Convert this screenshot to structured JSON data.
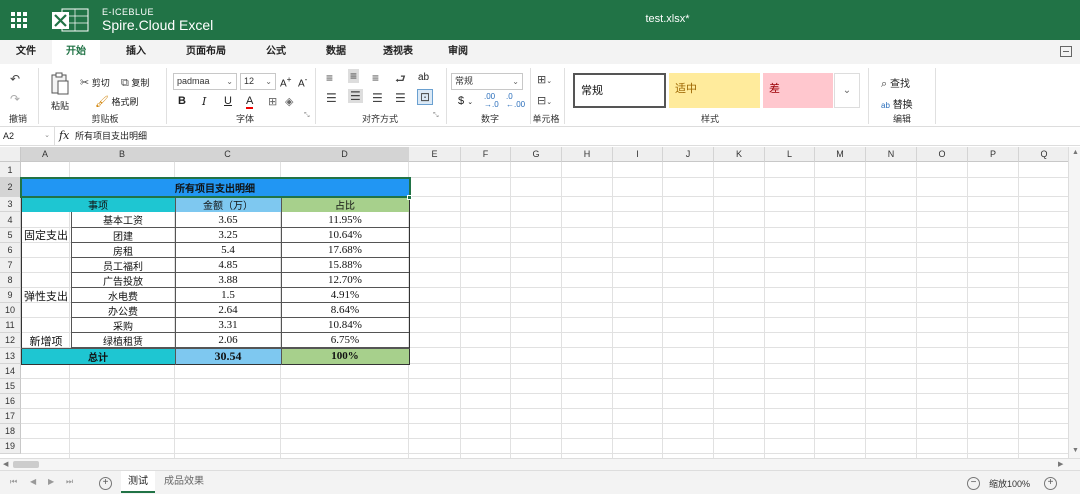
{
  "app": {
    "brand_top": "E-ICEBLUE",
    "brand_name": "Spire.Cloud Excel",
    "doc_title": "test.xlsx*"
  },
  "menu_tabs": [
    "文件",
    "开始",
    "插入",
    "页面布局",
    "公式",
    "数据",
    "透视表",
    "审阅"
  ],
  "ribbon": {
    "undo": "撤销",
    "paste": "粘贴",
    "cut": "剪切",
    "copy": "复制",
    "format_painter": "格式刷",
    "clipboard_label": "剪贴板",
    "font_name": "padmaa",
    "font_size": "12",
    "font_label": "字体",
    "bold": "B",
    "italic": "I",
    "underline": "U",
    "font_color": "A",
    "align_label": "对齐方式",
    "orientation": "ab",
    "number_format": "常规",
    "currency": "$",
    "percent": "%",
    "number_label": "数字",
    "cells_label": "单元格",
    "styles": {
      "normal": "常规",
      "neutral": "适中",
      "bad": "差"
    },
    "styles_label": "样式",
    "find": "查找",
    "replace": "替换",
    "edit_label": "编辑"
  },
  "formula_bar": {
    "cell_ref": "A2",
    "fx": "fx",
    "content": "所有项目支出明细"
  },
  "columns": [
    "A",
    "B",
    "C",
    "D",
    "E",
    "F",
    "G",
    "H",
    "I",
    "J",
    "K",
    "L",
    "M",
    "N",
    "O",
    "P",
    "Q"
  ],
  "rows": [
    "1",
    "2",
    "3",
    "4",
    "5",
    "6",
    "7",
    "8",
    "9",
    "10",
    "11",
    "12",
    "13",
    "14",
    "15",
    "16",
    "17",
    "18",
    "19"
  ],
  "table": {
    "title": "所有项目支出明细",
    "headers": [
      "事项",
      "金额（万）",
      "占比"
    ],
    "groups": [
      "固定支出",
      "弹性支出",
      "新增项"
    ],
    "items": [
      {
        "name": "基本工资",
        "amount": "3.65",
        "ratio": "11.95%"
      },
      {
        "name": "团建",
        "amount": "3.25",
        "ratio": "10.64%"
      },
      {
        "name": "房租",
        "amount": "5.4",
        "ratio": "17.68%"
      },
      {
        "name": "员工福利",
        "amount": "4.85",
        "ratio": "15.88%"
      },
      {
        "name": "广告投放",
        "amount": "3.88",
        "ratio": "12.70%"
      },
      {
        "name": "水电费",
        "amount": "1.5",
        "ratio": "4.91%"
      },
      {
        "name": "办公费",
        "amount": "2.64",
        "ratio": "8.64%"
      },
      {
        "name": "采购",
        "amount": "3.31",
        "ratio": "10.84%"
      },
      {
        "name": "绿植租赁",
        "amount": "2.06",
        "ratio": "6.75%"
      }
    ],
    "total_label": "总计",
    "total_amount": "30.54",
    "total_ratio": "100%"
  },
  "sheets": [
    "测试",
    "成品效果"
  ],
  "zoom": "缩放100%",
  "colors": {
    "brand_green": "#217346",
    "title_blue": "#2196f3",
    "cyan": "#1ec6d2",
    "light_blue": "#7ec8f0",
    "green": "#a7d08c",
    "neutral_yellow": "#ffeb9c",
    "bad_pink": "#ffc7ce"
  }
}
